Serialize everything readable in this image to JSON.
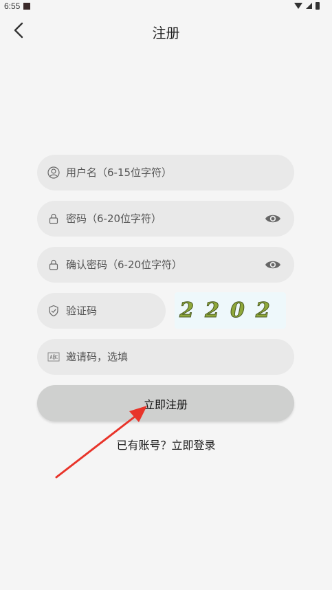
{
  "status_bar": {
    "time": "6:55"
  },
  "header": {
    "title": "注册"
  },
  "form": {
    "username_placeholder": "用户名（6-15位字符）",
    "password_placeholder": "密码（6-20位字符）",
    "confirm_password_placeholder": "确认密码（6-20位字符）",
    "captcha_placeholder": "验证码",
    "captcha_image_text": "2202",
    "invite_code_placeholder": "邀请码，选填",
    "submit_label": "立即注册"
  },
  "footer": {
    "login_link": "已有账号？立即登录"
  },
  "icons": {
    "back": "chevron-left-icon",
    "username": "user-icon",
    "password": "lock-icon",
    "confirm_password": "lock-icon",
    "show_password": "eye-icon",
    "captcha": "shield-icon",
    "invite": "abc-icon"
  },
  "colors": {
    "background": "#f5f5f5",
    "field_background": "#e9e9e9",
    "button_background": "#cfd0cf",
    "annotation_arrow": "#e8342a"
  }
}
